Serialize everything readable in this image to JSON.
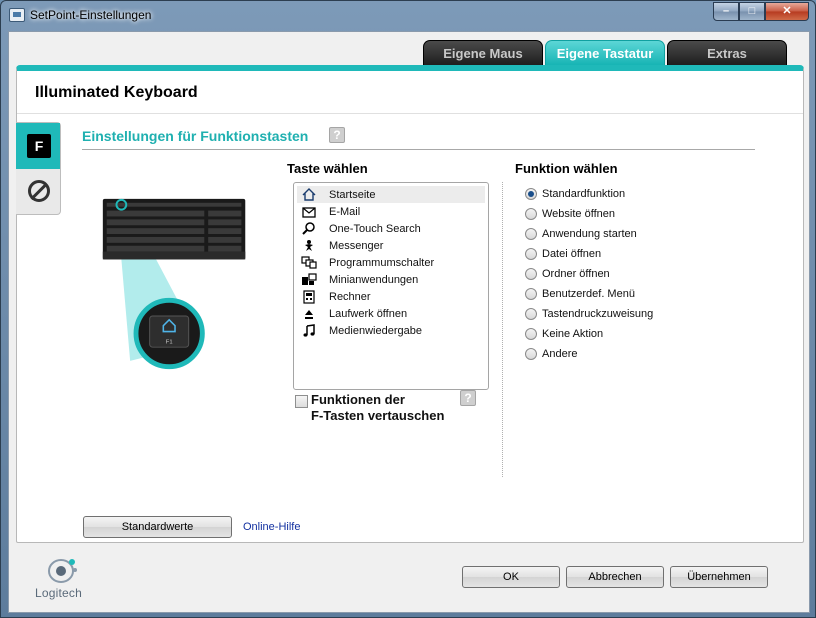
{
  "window": {
    "title": "SetPoint-Einstellungen"
  },
  "tabs": [
    {
      "label": "Eigene Maus",
      "active": false
    },
    {
      "label": "Eigene Tastatur",
      "active": true
    },
    {
      "label": "Extras",
      "active": false
    }
  ],
  "panel": {
    "device_title": "Illuminated Keyboard",
    "section_title": "Einstellungen für Funktionstasten",
    "help_label": "?",
    "side_tabs": {
      "f_label": "F"
    },
    "key_illustration": {
      "key_label": "F1"
    }
  },
  "taste": {
    "heading": "Taste wählen",
    "items": [
      {
        "label": "Startseite",
        "icon": "home-icon",
        "selected": true
      },
      {
        "label": "E-Mail",
        "icon": "email-icon",
        "selected": false
      },
      {
        "label": "One-Touch Search",
        "icon": "search-icon",
        "selected": false
      },
      {
        "label": "Messenger",
        "icon": "messenger-icon",
        "selected": false
      },
      {
        "label": "Programmumschalter",
        "icon": "app-switcher-icon",
        "selected": false
      },
      {
        "label": "Minianwendungen",
        "icon": "gadgets-icon",
        "selected": false
      },
      {
        "label": "Rechner",
        "icon": "calculator-icon",
        "selected": false
      },
      {
        "label": "Laufwerk öffnen",
        "icon": "eject-icon",
        "selected": false
      },
      {
        "label": "Medienwiedergabe",
        "icon": "music-icon",
        "selected": false
      }
    ],
    "swap_checkbox": {
      "line1": "Funktionen der",
      "line2": "F-Tasten vertauschen",
      "checked": false
    }
  },
  "funktion": {
    "heading": "Funktion wählen",
    "options": [
      {
        "label": "Standardfunktion",
        "checked": true
      },
      {
        "label": "Website öffnen",
        "checked": false
      },
      {
        "label": "Anwendung starten",
        "checked": false
      },
      {
        "label": "Datei öffnen",
        "checked": false
      },
      {
        "label": "Ordner öffnen",
        "checked": false
      },
      {
        "label": "Benutzerdef. Menü",
        "checked": false
      },
      {
        "label": "Tastendruckzuweisung",
        "checked": false
      },
      {
        "label": "Keine Aktion",
        "checked": false
      },
      {
        "label": "Andere",
        "checked": false
      }
    ]
  },
  "bottom": {
    "defaults_button": "Standardwerte",
    "help_link": "Online-Hilfe"
  },
  "footer": {
    "ok": "OK",
    "cancel": "Abbrechen",
    "apply": "Übernehmen",
    "brand": "Logitech"
  },
  "colors": {
    "accent": "#1fb9b9",
    "tab_dark": "#1c1c1c",
    "link": "#1230a0"
  }
}
